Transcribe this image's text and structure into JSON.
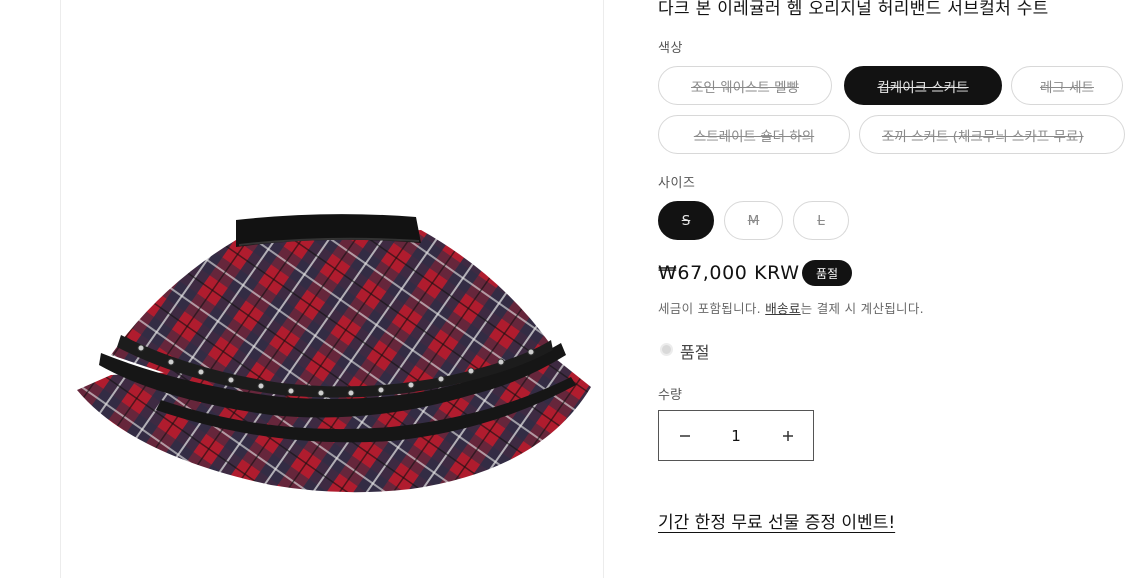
{
  "product": {
    "title": "다크 본 이레귤러 헴 오리지널 허리밴드 서브컬처 수트"
  },
  "color_option": {
    "label": "색상",
    "choices": [
      {
        "label": "조인 웨이스트 멜빵",
        "selected": false
      },
      {
        "label": "컵케이크 스커트",
        "selected": true
      },
      {
        "label": "레그 세트",
        "selected": false
      },
      {
        "label": "스트레이트 숄더 하의",
        "selected": false
      },
      {
        "label": "조끼 스커트 (체크무늬 스카프 무료)",
        "selected": false
      }
    ]
  },
  "size_option": {
    "label": "사이즈",
    "choices": [
      {
        "label": "S",
        "selected": true
      },
      {
        "label": "M",
        "selected": false
      },
      {
        "label": "L",
        "selected": false
      }
    ]
  },
  "price": {
    "amount": "₩67,000 KRW",
    "badge": "품절"
  },
  "tax_note": {
    "prefix": "세금이 포함됩니다. ",
    "link": "배송료",
    "suffix": "는 결제 시 계산됩니다."
  },
  "stock_status": "품절",
  "quantity": {
    "label": "수량",
    "value": "1",
    "minus_icon": "minus-icon",
    "plus_icon": "plus-icon"
  },
  "promo_link": "기간 한정 무료 선물 증정 이벤트!",
  "colors": {
    "plaid_red": "#b01c2e",
    "plaid_navy": "#2a2d45",
    "waistband": "#121212",
    "selected_pill": "#121212"
  }
}
